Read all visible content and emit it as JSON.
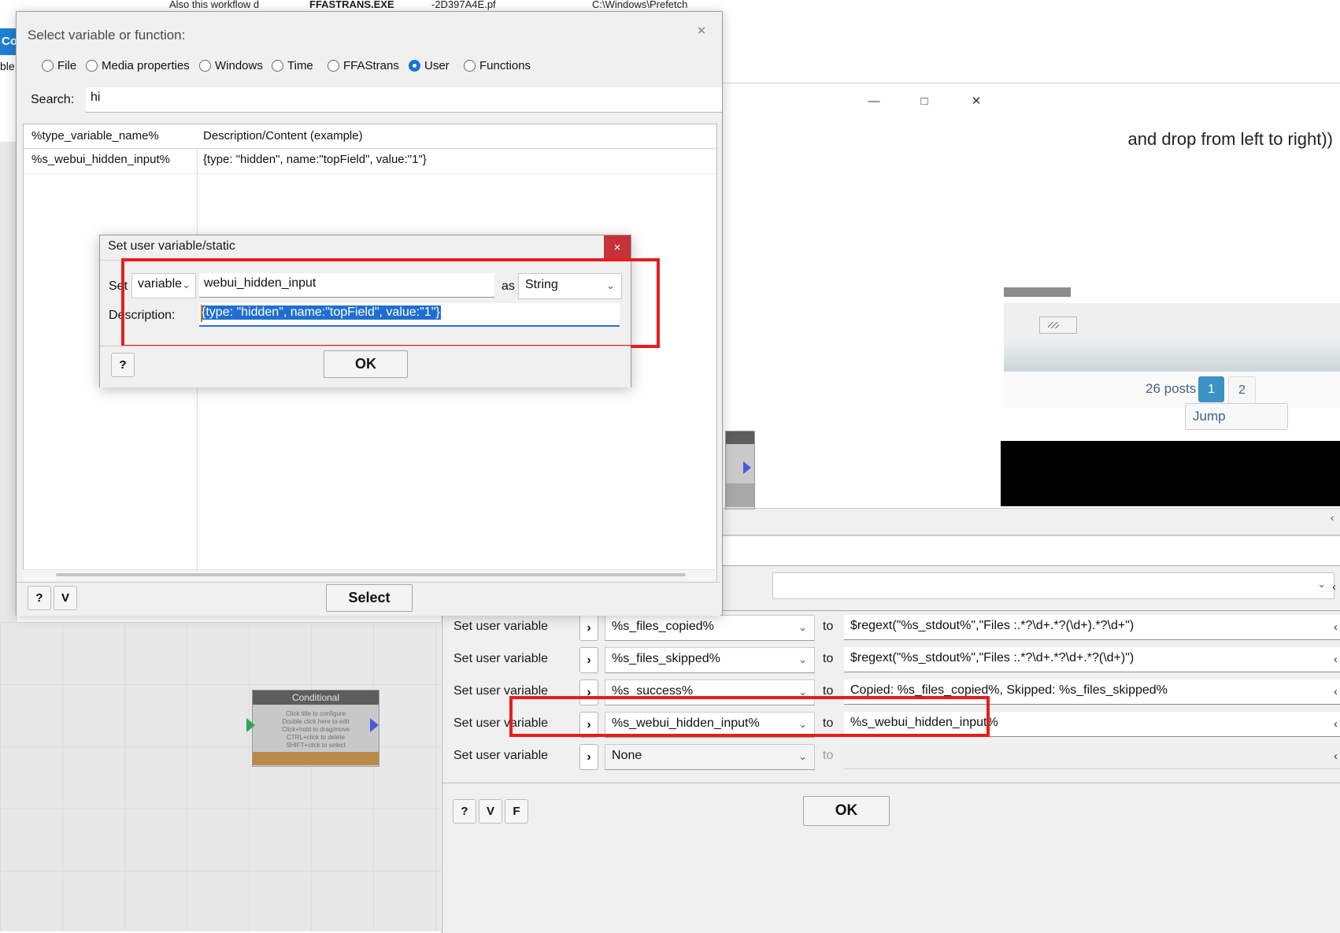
{
  "desktop": {
    "top_strip": {
      "left_text": "Also this workflow d",
      "exe_bold": "FFASTRANS.EXE",
      "exe_rest": "-2D397A4E.pf",
      "path": "C:\\Windows\\Prefetch"
    },
    "left_tab_label": "Co",
    "left_word": "ble"
  },
  "browser": {
    "minimize_label": "—",
    "maximize_label": "□",
    "close_label": "✕",
    "header_text": "and drop from left to right))",
    "posts_count": "26 posts",
    "page_1": "1",
    "page_2": "2",
    "jump_label": "Jump",
    "scroll_arrow": "‹"
  },
  "canvas": {
    "conditional": {
      "title": "Conditional",
      "body": "Click title to configure\nDouble click here to edit\nClick+hold to drag/move\nCTRL+click to delete\nSHIFT+click to select"
    }
  },
  "set_user_variable_panel": {
    "row_label": "Set user variable",
    "chevron": "›",
    "to_label": "to",
    "rows": [
      {
        "variable": "%s_files_copied%",
        "value": "$regext(\"%s_stdout%\",\"Files :.*?\\d+.*?(\\d+).*?\\d+\")",
        "highlighted": false,
        "disabled": false
      },
      {
        "variable": "%s_files_skipped%",
        "value": "$regext(\"%s_stdout%\",\"Files :.*?\\d+.*?\\d+.*?(\\d+)\")",
        "highlighted": false,
        "disabled": false
      },
      {
        "variable": "%s_success%",
        "value": "Copied: %s_files_copied%, Skipped: %s_files_skipped%",
        "highlighted": false,
        "disabled": false
      },
      {
        "variable": "%s_webui_hidden_input%",
        "value": "%s_webui_hidden_input%",
        "highlighted": true,
        "disabled": false
      },
      {
        "variable": "None",
        "value": "",
        "highlighted": false,
        "disabled": true
      }
    ],
    "footer": {
      "help_label": "?",
      "variable_label": "V",
      "function_label": "F",
      "ok_label": "OK"
    },
    "row_arrow": "‹"
  },
  "select_variable_dialog": {
    "title": "Select variable or function:",
    "close_label": "✕",
    "categories": [
      {
        "label": "File",
        "selected": false
      },
      {
        "label": "Media properties",
        "selected": false
      },
      {
        "label": "Windows",
        "selected": false
      },
      {
        "label": "Time",
        "selected": false
      },
      {
        "label": "FFAStrans",
        "selected": false
      },
      {
        "label": "User",
        "selected": true
      },
      {
        "label": "Functions",
        "selected": false
      }
    ],
    "search_label": "Search:",
    "search_value": "hi",
    "search_placeholder": "",
    "columns": [
      "%type_variable_name%",
      "Description/Content (example)"
    ],
    "rows": [
      {
        "name": "%s_webui_hidden_input%",
        "description": "{type: \"hidden\", name:\"topField\", value:\"1\"}"
      }
    ],
    "footer": {
      "help_label": "?",
      "variable_label": "V",
      "select_label": "Select"
    }
  },
  "set_user_variable_static_dialog": {
    "title": "Set user variable/static",
    "close_label": "×",
    "set_label": "Set",
    "kind_value": "variable",
    "kind_caret": "⌄",
    "name_value": "webui_hidden_input",
    "as_label": "as",
    "type_value": "String",
    "type_caret": "⌄",
    "description_label": "Description:",
    "description_value": "{type: \"hidden\", name:\"topField\", value:\"1\"}",
    "help_label": "?",
    "ok_label": "OK"
  }
}
